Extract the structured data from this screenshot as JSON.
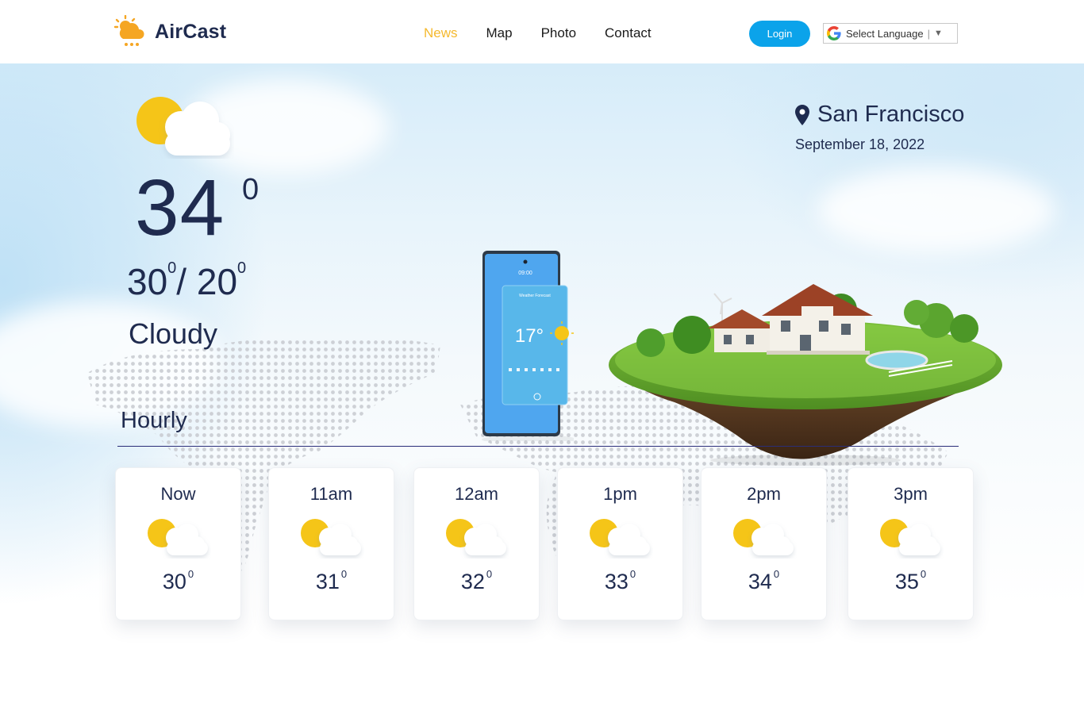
{
  "brand": {
    "name": "AirCast",
    "logo_icon": "sun-cloud-rain-icon"
  },
  "nav": {
    "items": [
      {
        "label": "News",
        "active": true
      },
      {
        "label": "Map",
        "active": false
      },
      {
        "label": "Photo",
        "active": false
      },
      {
        "label": "Contact",
        "active": false
      }
    ]
  },
  "header": {
    "login_label": "Login",
    "language_label": "Select Language",
    "language_arrow": "▼"
  },
  "current": {
    "icon": "partly-cloudy-icon",
    "temperature": "34",
    "degree_mark": "0",
    "high": "30",
    "low": "20",
    "range_degree_mark": "0",
    "range_sep": "/",
    "condition": "Cloudy"
  },
  "location": {
    "city": "San Francisco",
    "date": "September 18, 2022"
  },
  "hourly": {
    "title": "Hourly",
    "items": [
      {
        "time": "Now",
        "temp": "30",
        "deg": "0"
      },
      {
        "time": "11am",
        "temp": "31",
        "deg": "0"
      },
      {
        "time": "12am",
        "temp": "32",
        "deg": "0"
      },
      {
        "time": "1pm",
        "temp": "33",
        "deg": "0"
      },
      {
        "time": "2pm",
        "temp": "34",
        "deg": "0"
      },
      {
        "time": "3pm",
        "temp": "35",
        "deg": "0"
      }
    ]
  },
  "colors": {
    "accent_active": "#f5b92e",
    "login_bg": "#0ba3ea",
    "text_primary": "#1f2b4f",
    "sun": "#f5c518"
  }
}
